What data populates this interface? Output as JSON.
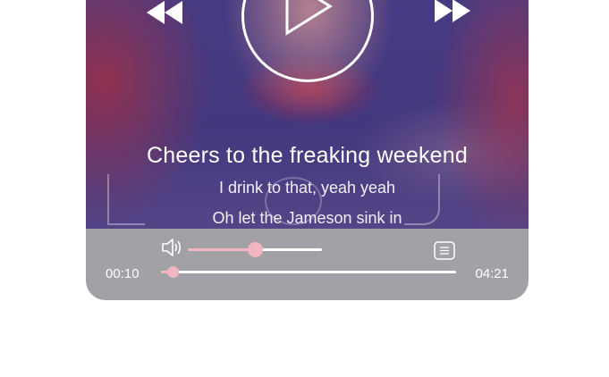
{
  "player": {
    "lyrics": {
      "current": "Cheers to the freaking weekend",
      "next": "I drink to that, yeah yeah",
      "after": "Oh let the Jameson sink in"
    },
    "controls": {
      "prev_icon": "rewind-icon",
      "play_icon": "play-icon",
      "next_icon": "fast-forward-icon",
      "volume_icon": "volume-icon",
      "lyrics_icon": "lyrics-list-icon"
    },
    "volume": {
      "level": 0.5
    },
    "progress": {
      "current_time": "00:10",
      "total_time": "04:21",
      "fraction": 0.04
    },
    "colors": {
      "accent": "#f1b6c1",
      "bar_background": "#a2a2a6",
      "text": "#ffffff"
    }
  }
}
